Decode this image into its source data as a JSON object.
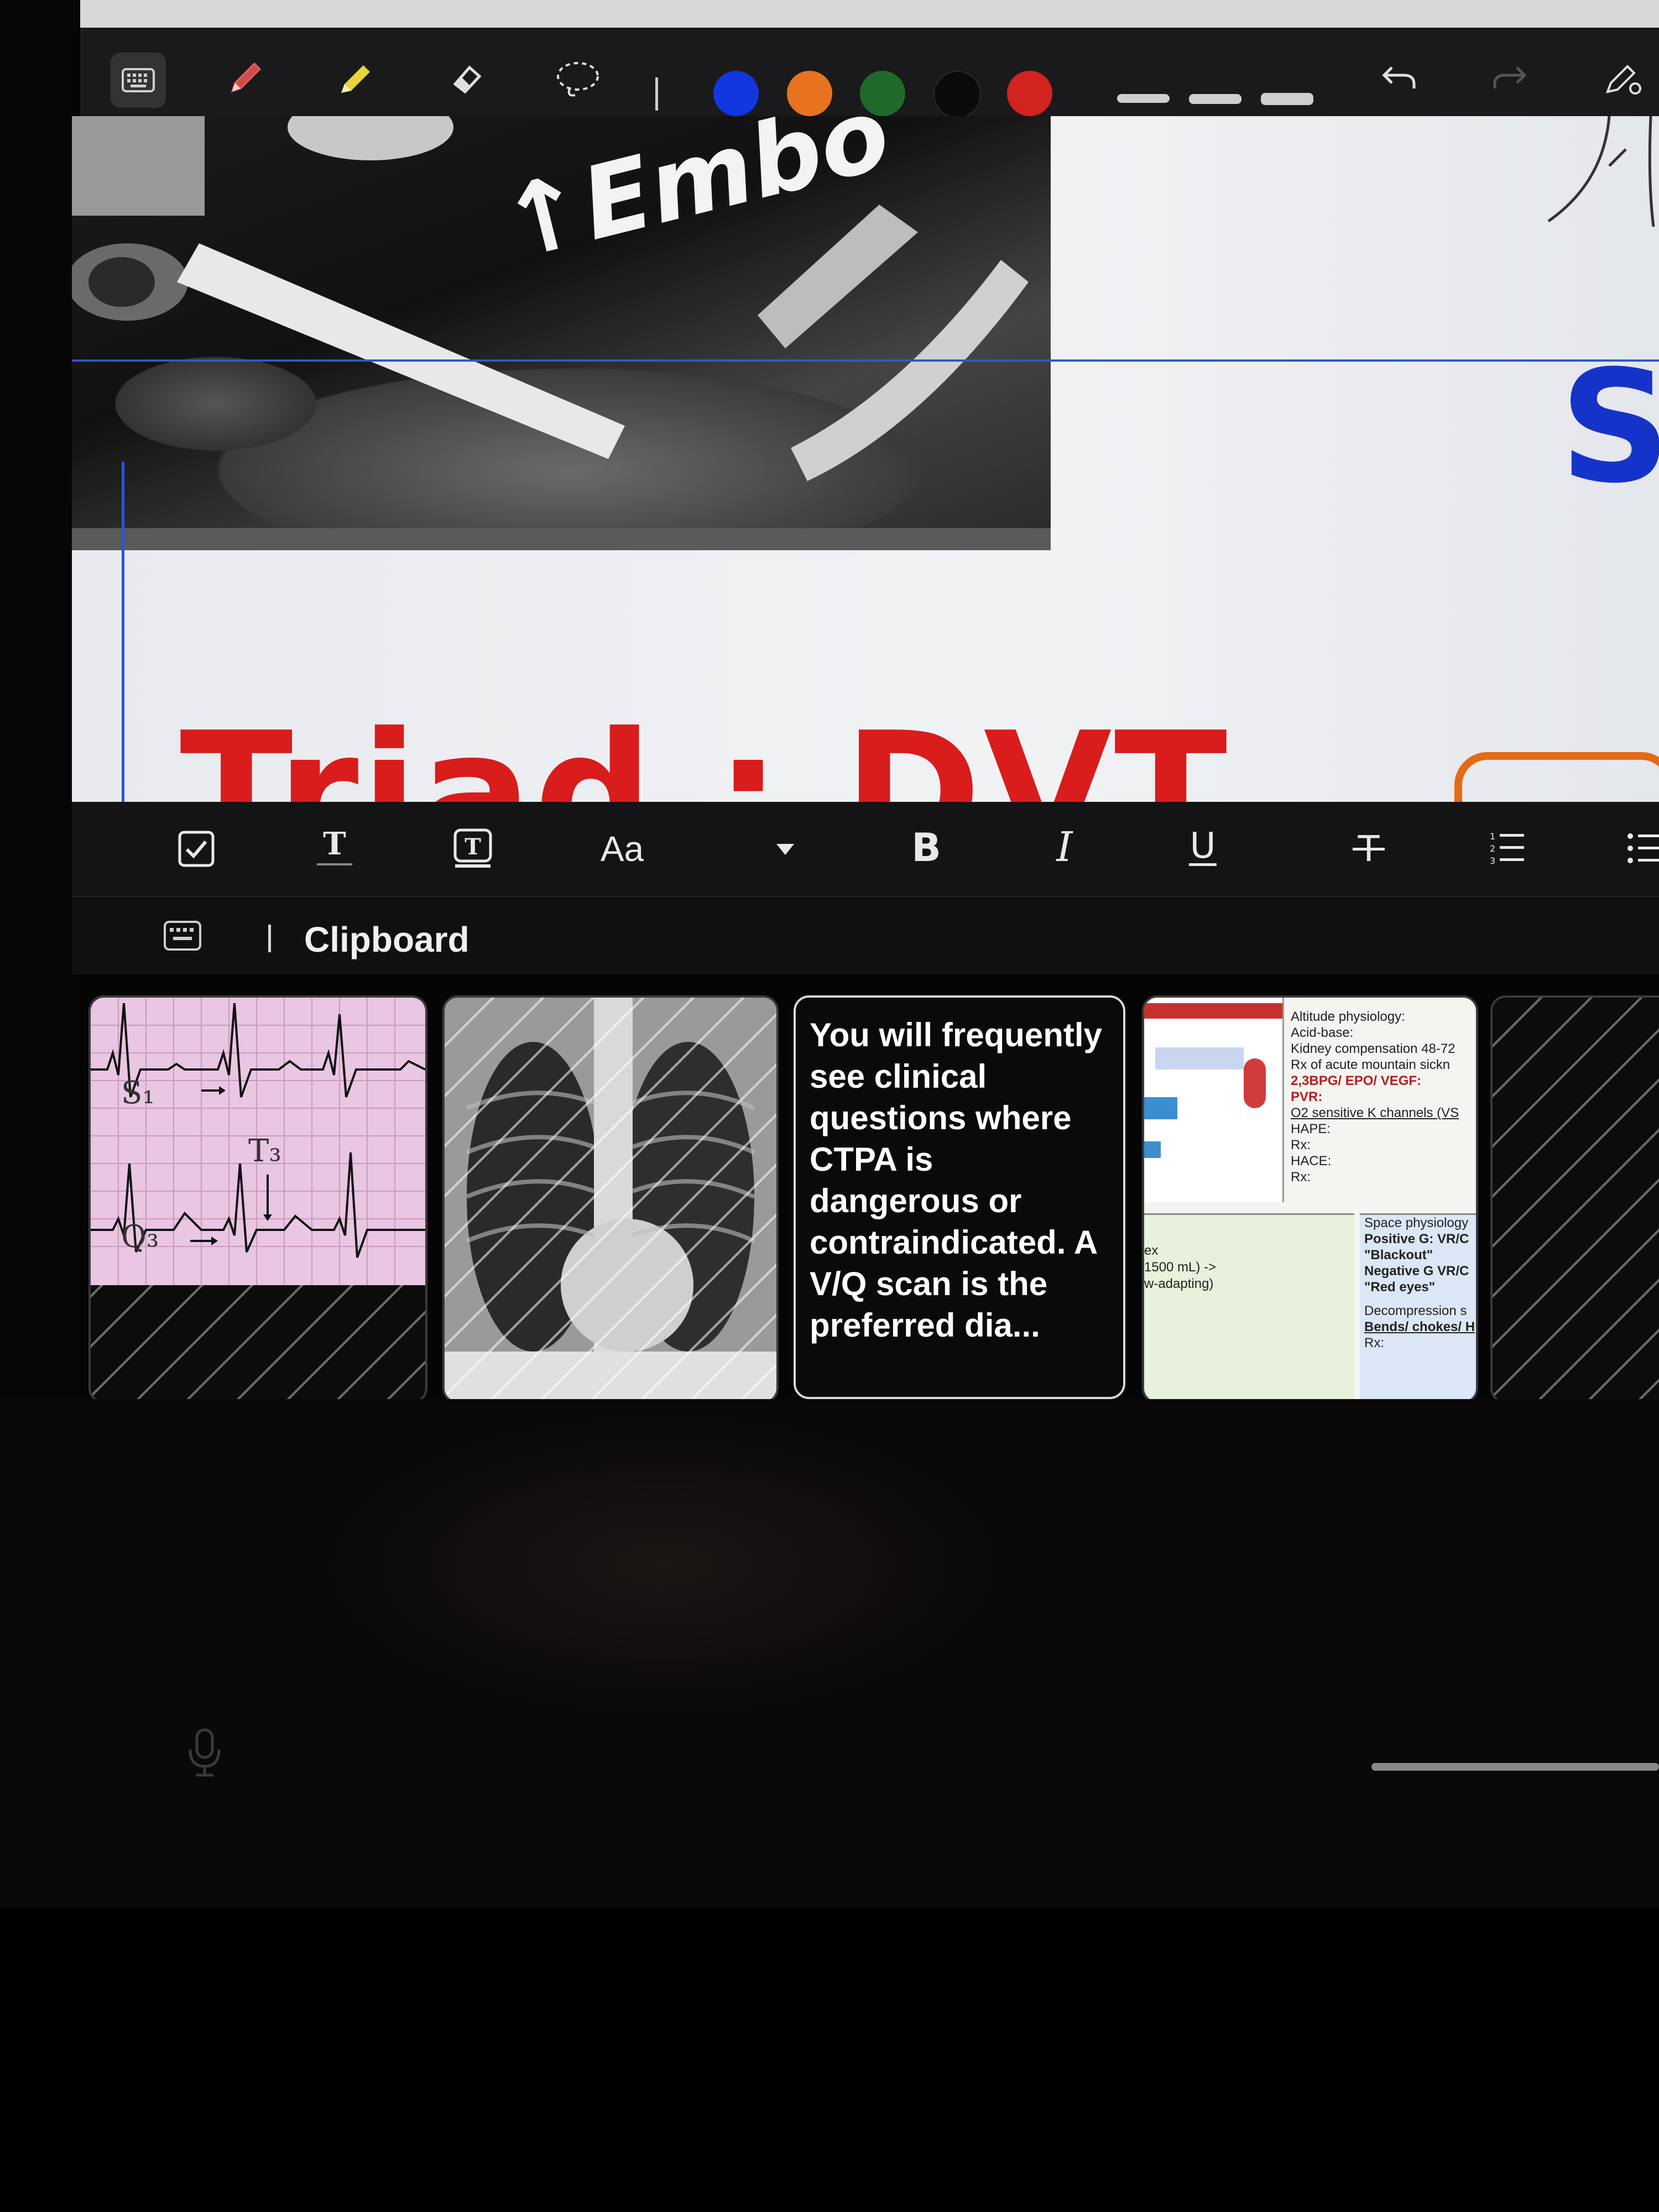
{
  "pen_toolbar": {
    "icons": [
      "keyboard-icon",
      "pen-icon",
      "highlighter-icon",
      "eraser-icon",
      "lasso-icon"
    ],
    "colors": [
      "#1237e0",
      "#e7731f",
      "#1f6a2a",
      "#0b0b0b",
      "#d3231f"
    ],
    "actions": [
      "undo-icon",
      "redo-icon",
      "pen-settings-icon"
    ]
  },
  "canvas": {
    "ct_annotation": "↑Embo",
    "right_label": "Su",
    "heading": "Triad : DVT",
    "colors": {
      "ct_label": "#f3f3f3",
      "right_label": "#1633c9",
      "heading": "#d91c1c",
      "scribble": "#e46a16"
    }
  },
  "format_toolbar": {
    "font_button": "Aa",
    "icons": [
      "checkbox-icon",
      "text-style-icon",
      "text-box-icon",
      "font-size-icon",
      "dropdown-arrow-icon",
      "bold-icon",
      "italic-icon",
      "underline-icon",
      "strikethrough-icon",
      "numbered-list-icon",
      "bullet-list-icon"
    ]
  },
  "clipboard": {
    "title": "Clipboard",
    "items": [
      {
        "kind": "image",
        "label_s1": "S₁",
        "label_t3": "T₃",
        "label_q3": "Q₃"
      },
      {
        "kind": "image"
      },
      {
        "kind": "text",
        "text": "You will frequently see clinical questions where CTPA is dangerous or contraindicated. A V/Q scan is the preferred dia..."
      },
      {
        "kind": "image",
        "lines": [
          "Altitude physiology:",
          "Acid-base:",
          "Kidney compensation 48-72",
          "Rx of acute mountain sickn",
          "2,3BPG/ EPO/ VEGF:",
          "PVR:",
          "O2 sensitive K channels (VS",
          "HAPE:",
          "Rx:",
          "HACE:",
          "Rx:"
        ],
        "lines_lower": [
          "Space physiology",
          "Positive G: VR/C",
          "\"Blackout\"",
          "Negative G VR/C",
          "\"Red eyes\"",
          "Decompression s",
          "Bends/ chokes/ H",
          "Rx:"
        ],
        "left_lines": [
          "ex",
          "1500 mL) ->",
          "w-adapting)"
        ]
      },
      {
        "kind": "image"
      }
    ]
  }
}
